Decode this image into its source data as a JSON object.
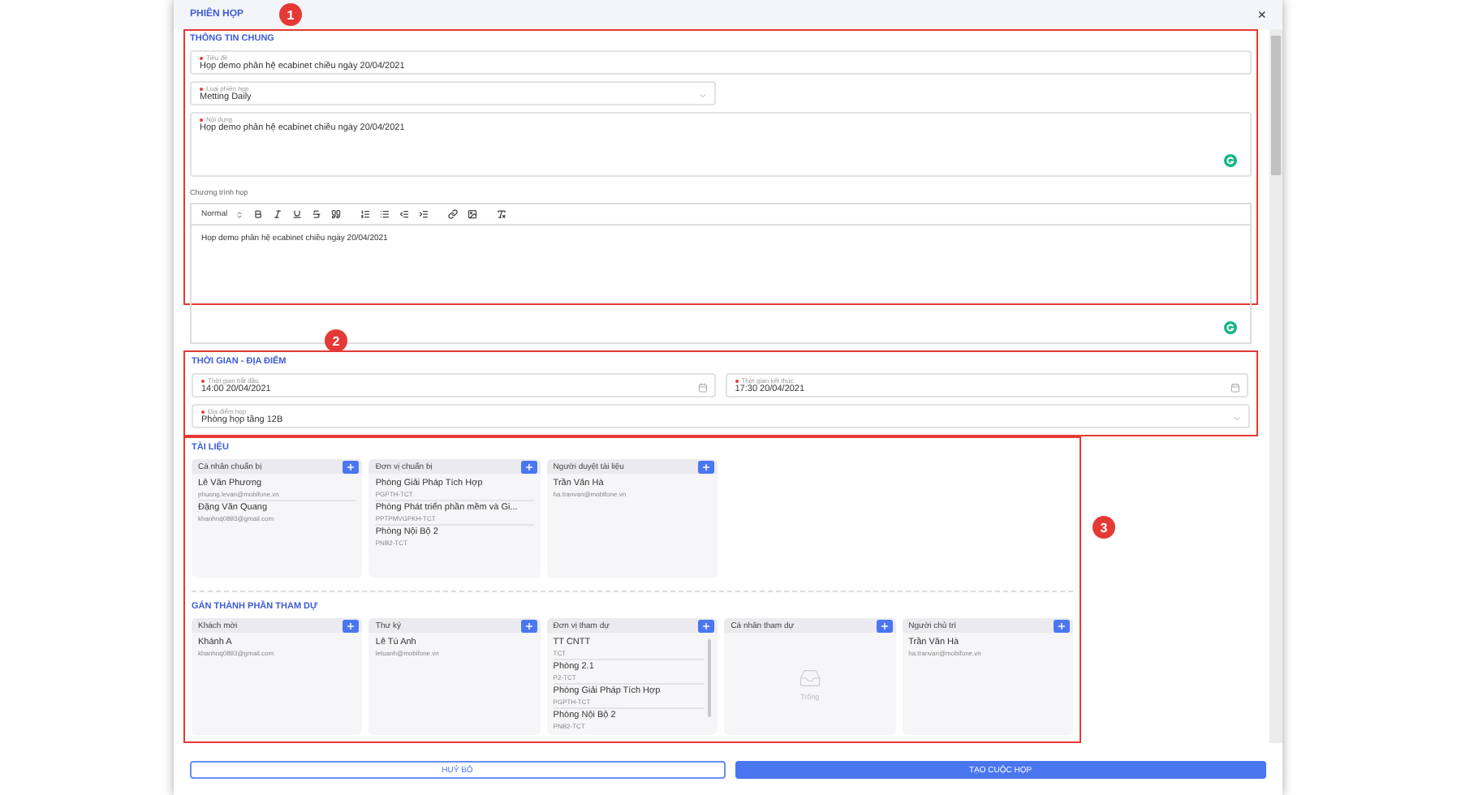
{
  "dialog": {
    "title": "PHIÊN HỌP",
    "badge": "1",
    "close": "×"
  },
  "general": {
    "title": "THÔNG TIN CHUNG",
    "fields": [
      {
        "kind": "text",
        "label": "Tiêu đề",
        "required": true,
        "value": "Họp demo phân hệ ecabinet chiều ngày 20/04/2021"
      },
      {
        "kind": "select",
        "label": "Loại phiên họp",
        "required": true,
        "value": "Metting Daily"
      },
      {
        "kind": "textarea",
        "label": "Nội dung",
        "required": true,
        "value": "Họp demo phân hệ ecabinet chiều ngày 20/04/2021"
      }
    ],
    "agenda": {
      "label": "Chương trình họp",
      "format": "Normal",
      "content": "Họp demo phân hệ ecabinet chiều ngày 20/04/2021"
    }
  },
  "time_place": {
    "title": "THỜI GIAN - ĐỊA ĐIỂM",
    "badge": "2",
    "fields": [
      {
        "kind": "date",
        "label": "Thời gian bắt đầu",
        "required": true,
        "value": "14:00 20/04/2021"
      },
      {
        "kind": "date",
        "label": "Thời gian kết thúc",
        "required": true,
        "value": "17:30 20/04/2021"
      },
      {
        "kind": "select",
        "label": "Địa điểm họp",
        "required": true,
        "value": "Phòng họp tầng 12B"
      }
    ]
  },
  "participants": {
    "badge": "3",
    "groups": [
      {
        "title": "TÀI LIỆU",
        "lists": [
          {
            "title": "Cá nhân chuẩn bị",
            "items": [
              {
                "name": "Lê Văn Phương",
                "detail": "phuong.levan@mobifone.vn"
              },
              {
                "name": "Đặng Văn Quang",
                "detail": "khanhnq0893@gmail.com"
              }
            ]
          },
          {
            "title": "Đơn vị chuẩn bị",
            "items": [
              {
                "name": "Phòng Giải Pháp Tích Hợp",
                "detail": "PGPTH-TCT"
              },
              {
                "name": "Phòng Phát triển phần mềm và Gi...",
                "detail": "PPTPMVGPKH-TCT"
              },
              {
                "name": "Phòng Nội Bộ 2",
                "detail": "PNB2-TCT"
              }
            ]
          },
          {
            "title": "Người duyệt tài liệu",
            "items": [
              {
                "name": "Trần Văn Hà",
                "detail": "ha.tranvan@mobifone.vn"
              }
            ]
          }
        ]
      },
      {
        "title": "GÁN THÀNH PHẦN THAM DỰ",
        "lists": [
          {
            "title": "Khách mời",
            "items": [
              {
                "name": "Khánh A",
                "detail": "khanhnq0893@gmail.com"
              }
            ]
          },
          {
            "title": "Thư ký",
            "items": [
              {
                "name": "Lê Tú Anh",
                "detail": "letuanh@mobifone.vn"
              }
            ]
          },
          {
            "title": "Đơn vị tham dự",
            "scrolls": true,
            "items": [
              {
                "name": "TT CNTT",
                "detail": "TCT"
              },
              {
                "name": "Phòng 2.1",
                "detail": "P2-TCT"
              },
              {
                "name": "Phòng Giải Pháp Tích Hợp",
                "detail": "PGPTH-TCT"
              },
              {
                "name": "Phòng Nội Bộ 2",
                "detail": "PNB2-TCT"
              }
            ]
          },
          {
            "title": "Cá nhân tham dự",
            "empty": "Trống"
          },
          {
            "title": "Người chủ trì",
            "items": [
              {
                "name": "Trần Văn Hà",
                "detail": "ha.tranvan@mobifone.vn"
              }
            ]
          }
        ]
      }
    ]
  },
  "buttons": [
    {
      "kind": "secondary",
      "label": "HUỶ BỎ"
    },
    {
      "kind": "primary",
      "label": "TẠO CUỘC HỌP"
    }
  ]
}
